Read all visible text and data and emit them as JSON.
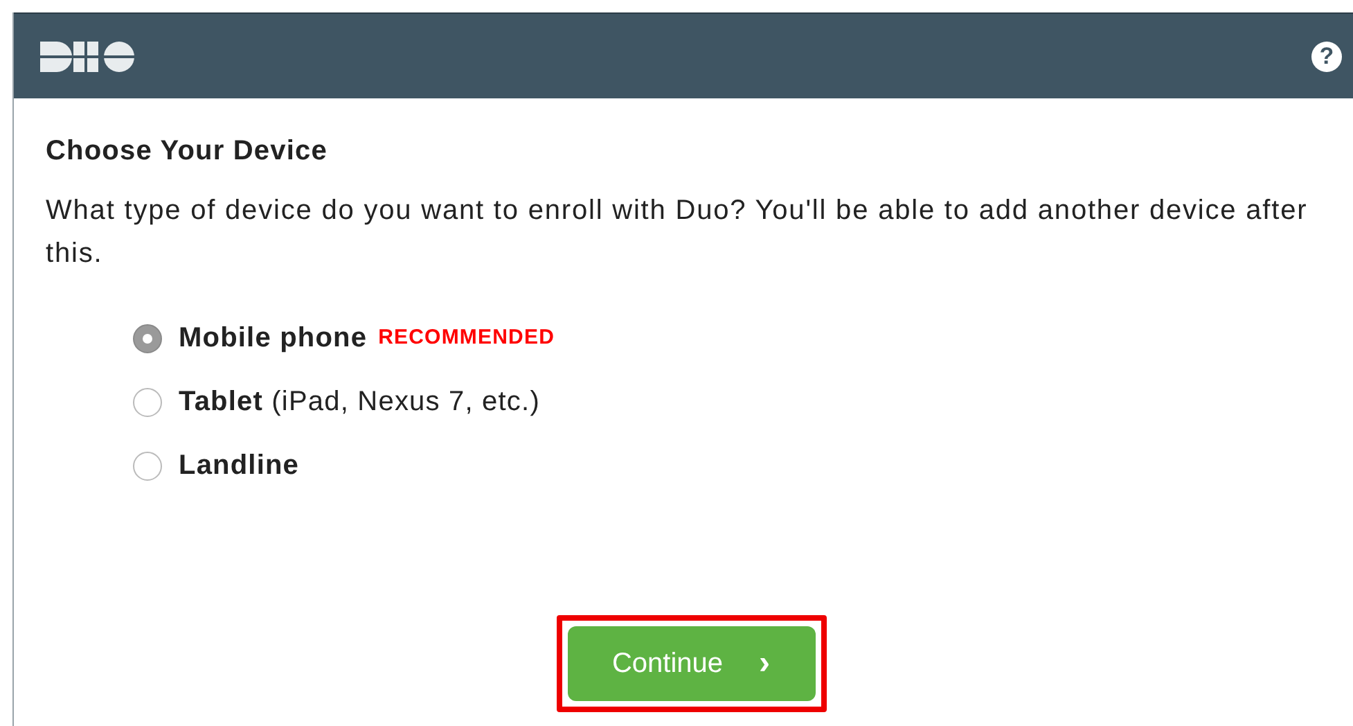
{
  "header": {
    "help": "?"
  },
  "title": "Choose Your Device",
  "description": "What type of device do you want to enroll with Duo? You'll be able to add another device after this.",
  "options": [
    {
      "label": "Mobile phone",
      "badge": "RECOMMENDED",
      "selected": true
    },
    {
      "label": "Tablet",
      "detail": "(iPad, Nexus 7, etc.)",
      "selected": false
    },
    {
      "label": "Landline",
      "selected": false
    }
  ],
  "continue_button": {
    "label": "Continue",
    "arrow": "›",
    "highlighted": true
  }
}
